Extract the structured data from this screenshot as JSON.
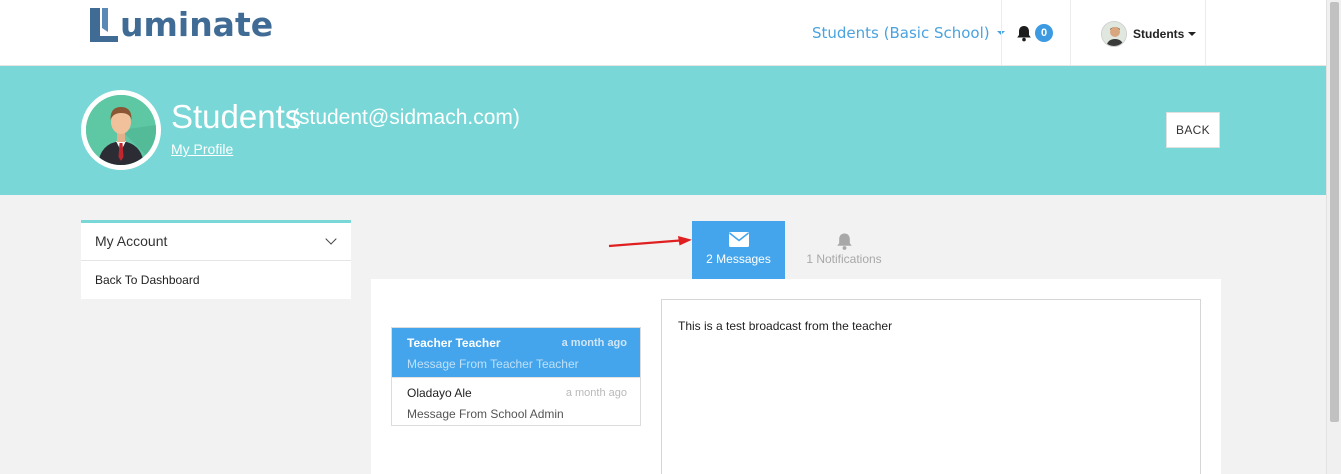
{
  "app": {
    "logo_text": "uminate"
  },
  "navbar": {
    "school_selector": "Students (Basic School)",
    "notification_count": "0",
    "user_label": "Students"
  },
  "profile": {
    "name": "Students",
    "email": "(student@sidmach.com)",
    "profile_link": "My Profile",
    "back_button": "BACK"
  },
  "sidebar": {
    "header": "My Account",
    "items": [
      {
        "label": "Back To Dashboard"
      }
    ]
  },
  "tabs": [
    {
      "label": "2 Messages",
      "icon": "envelope-icon",
      "active": true
    },
    {
      "label": "1 Notifications",
      "icon": "bell-icon",
      "active": false
    }
  ],
  "messages": [
    {
      "sender": "Teacher Teacher",
      "time": "a month ago",
      "subject": "Message From Teacher Teacher",
      "selected": true
    },
    {
      "sender": "Oladayo Ale",
      "time": "a month ago",
      "subject": "Message From School Admin",
      "selected": false
    }
  ],
  "message_view": {
    "body": "This is a test broadcast from the teacher"
  },
  "colors": {
    "brand": "#3f6b94",
    "banner": "#79d7d7",
    "accent": "#44a5ec",
    "annotation_arrow": "#e02020"
  }
}
